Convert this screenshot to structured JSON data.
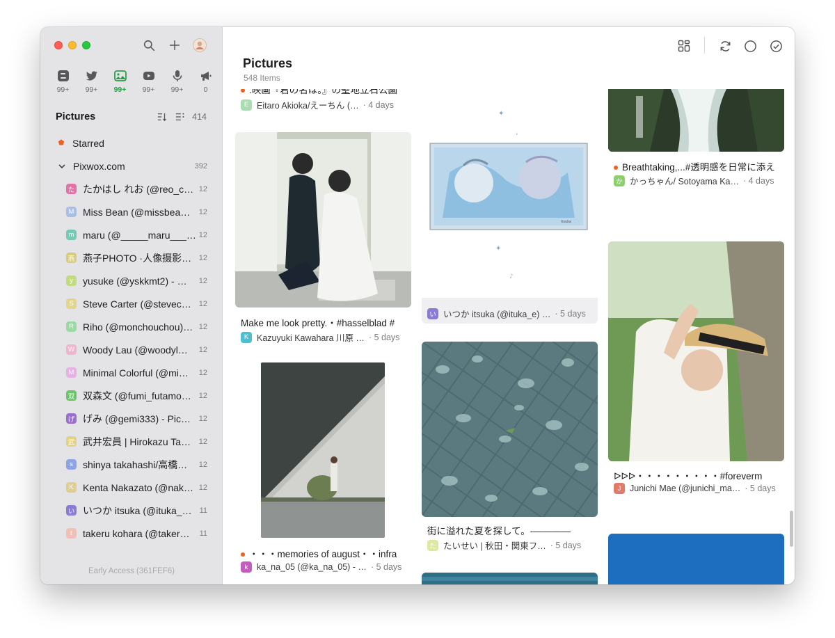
{
  "sidebar": {
    "sources": [
      {
        "icon": "blog-icon",
        "count": "99+"
      },
      {
        "icon": "twitter-icon",
        "count": "99+"
      },
      {
        "icon": "pictures-icon",
        "count": "99+"
      },
      {
        "icon": "youtube-icon",
        "count": "99+"
      },
      {
        "icon": "podcast-icon",
        "count": "99+"
      },
      {
        "icon": "announcement-icon",
        "count": "0"
      }
    ],
    "section_title": "Pictures",
    "section_count": "414",
    "starred": "Starred",
    "group": {
      "label": "Pixwox.com",
      "count": "392"
    },
    "feeds": [
      {
        "initial": "た",
        "color": "#e072a8",
        "label": "たかはし れお (@reo_c…",
        "count": "12"
      },
      {
        "initial": "M",
        "color": "#a7bfe6",
        "label": "Miss Bean (@missbea…",
        "count": "12"
      },
      {
        "initial": "m",
        "color": "#78c9b4",
        "label": "maru (@_____maru___…",
        "count": "12"
      },
      {
        "initial": "燕",
        "color": "#d8cc7a",
        "label": "燕子PHOTO ·人像摄影…",
        "count": "12"
      },
      {
        "initial": "y",
        "color": "#c2dc7d",
        "label": "yusuke (@yskkmt2) - …",
        "count": "12"
      },
      {
        "initial": "S",
        "color": "#e3d58a",
        "label": "Steve Carter (@stevec…",
        "count": "12"
      },
      {
        "initial": "R",
        "color": "#99dba2",
        "label": "Riho (@monchouchou)…",
        "count": "12"
      },
      {
        "initial": "W",
        "color": "#f0b6cf",
        "label": "Woody Lau (@woodyl…",
        "count": "12"
      },
      {
        "initial": "M",
        "color": "#e5b2e3",
        "label": "Minimal Colorful (@mi…",
        "count": "12"
      },
      {
        "initial": "双",
        "color": "#6cc46a",
        "label": "双森文 (@fumi_futamo…",
        "count": "12"
      },
      {
        "initial": "げ",
        "color": "#9b6ed1",
        "label": "げみ (@gemi333) - Pic…",
        "count": "12"
      },
      {
        "initial": "武",
        "color": "#e3d08a",
        "label": "武井宏員 | Hirokazu Ta…",
        "count": "12"
      },
      {
        "initial": "s",
        "color": "#8fa4e6",
        "label": "shinya takahashi/高橋…",
        "count": "12"
      },
      {
        "initial": "K",
        "color": "#e0cd8f",
        "label": "Kenta Nakazato (@nak…",
        "count": "12"
      },
      {
        "initial": "い",
        "color": "#8a7cd4",
        "label": "いつか itsuka (@ituka_…",
        "count": "11"
      },
      {
        "initial": "t",
        "color": "#f4c0b6",
        "label": "takeru kohara (@taker…",
        "count": "11"
      }
    ],
    "footer": "Early Access (361FEF6)"
  },
  "main": {
    "title": "Pictures",
    "subtitle": "548 Items",
    "cards": {
      "c1": {
        "title": ".映画『君の名は。』の聖地立石公園",
        "author": "Eitaro Akioka/えーちん (…",
        "initial": "E",
        "color": "#a9dcb0",
        "age": "· 4 days",
        "unread": true
      },
      "c2": {
        "title": "Make me look pretty.・#hasselblad #",
        "author": "Kazuyuki Kawahara 川原 …",
        "initial": "K",
        "color": "#4fbfd0",
        "age": "· 5 days",
        "unread": false
      },
      "c3": {
        "title": "・・・memories of august・・infra",
        "author": "ka_na_05 (@ka_na_05) - …",
        "initial": "k",
        "color": "#c35bc1",
        "age": "· 5 days",
        "unread": true
      },
      "c4": {
        "title": "",
        "author": "いつか itsuka (@ituka_e) …",
        "initial": "い",
        "color": "#8a7cd4",
        "age": "· 5 days",
        "unread": false
      },
      "c5": {
        "title": "街に溢れた夏を探して。-————",
        "author": "たいせい | 秋田・関東フ…",
        "initial": "た",
        "color": "#dfe7a0",
        "age": "· 5 days",
        "unread": false
      },
      "c6": {
        "title": "Breathtaking,...#透明感を日常に添え",
        "author": "かっちゃん/ Sotoyama Ka…",
        "initial": "か",
        "color": "#8ccf6b",
        "age": "· 4 days",
        "unread": true
      },
      "c7": {
        "title": "ᐅᐅᐅ・・・・・・・・・#foreverm",
        "author": "Junichi Mae (@junichi_ma…",
        "initial": "J",
        "color": "#e07a6a",
        "age": "· 5 days",
        "unread": false
      }
    }
  }
}
